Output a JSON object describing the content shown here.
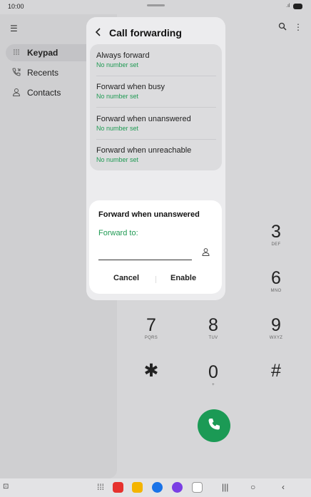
{
  "status_bar": {
    "time": "10:00"
  },
  "sidebar": {
    "items": [
      {
        "label": "Keypad",
        "icon": "keypad-icon",
        "active": true
      },
      {
        "label": "Recents",
        "icon": "recents-icon",
        "active": false
      },
      {
        "label": "Contacts",
        "icon": "contacts-icon",
        "active": false
      }
    ]
  },
  "keypad": {
    "keys": [
      {
        "num": "3",
        "sub": "DEF"
      },
      {
        "num": "6",
        "sub": "MNO"
      },
      {
        "num": "7",
        "sub": "PQRS"
      },
      {
        "num": "8",
        "sub": "TUV"
      },
      {
        "num": "9",
        "sub": "WXYZ"
      },
      {
        "num": "✱",
        "sub": ""
      },
      {
        "num": "0",
        "sub": "+"
      },
      {
        "num": "#",
        "sub": ""
      }
    ]
  },
  "call_forwarding": {
    "title": "Call forwarding",
    "options": [
      {
        "title": "Always forward",
        "status": "No number set"
      },
      {
        "title": "Forward when busy",
        "status": "No number set"
      },
      {
        "title": "Forward when unanswered",
        "status": "No number set"
      },
      {
        "title": "Forward when unreachable",
        "status": "No number set"
      }
    ]
  },
  "dialog": {
    "title": "Forward when unanswered",
    "field_label": "Forward to:",
    "field_value": "",
    "cancel_label": "Cancel",
    "enable_label": "Enable"
  },
  "colors": {
    "accent": "#1f9a53",
    "call_button": "#1b9a55"
  }
}
